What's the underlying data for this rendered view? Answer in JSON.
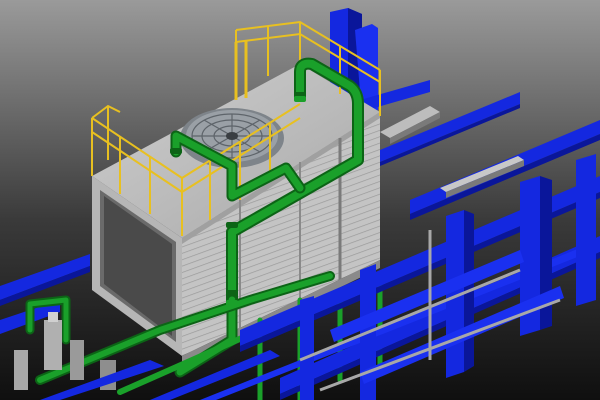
{
  "scene": {
    "subject": "cooling-tower-3d-model",
    "colors": {
      "background_top": "#9a9a9a",
      "background_bottom": "#0f0f0f",
      "steel_blue": "#1428e0",
      "steel_blue_dark": "#0a169a",
      "pipe_green": "#1aa02a",
      "pipe_green_dark": "#0c6416",
      "casing_gray": "#c8c8c8",
      "casing_dark": "#8a8a8a",
      "railing_yellow": "#e8c020",
      "fan_gray": "#9aa0a6"
    },
    "icons": [
      "fan-icon",
      "handrail",
      "flange",
      "valve"
    ]
  }
}
